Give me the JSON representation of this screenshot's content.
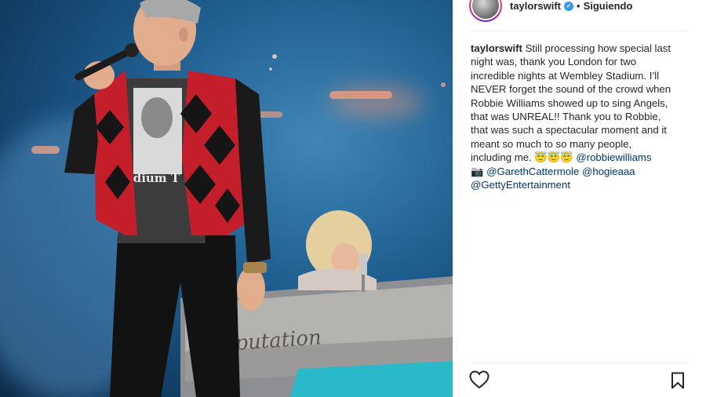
{
  "post": {
    "image_alt": "Robbie Williams singing on stage while Taylor Swift plays piano at Wembley Stadium",
    "piano_text": "putation",
    "shirt_text": "adium T"
  },
  "header": {
    "username": "taylorswift",
    "verified_icon": "verified-badge-icon",
    "separator": "•",
    "follow_status": "Siguiendo"
  },
  "caption": {
    "username": "taylorswift",
    "lines": [
      "Still processing how special last",
      "night was, thank you London for two",
      "incredible nights at Wembley Stadium. I’ll",
      "NEVER forget the sound of the crowd when",
      "Robbie Williams showed up to sing Angels,",
      "that was UNREAL!! Thank you to Robbie,",
      "that was such a spectacular moment and it",
      "meant so much to so many people,",
      "including me."
    ],
    "emojis": "😇😇😇",
    "mention_robbie": "@robbiewilliams",
    "camera_emoji": "📷",
    "mention_gareth": "@GarethCattermole",
    "mention_hogie": "@hogieaaa",
    "mention_getty": "@GettyEntertainment"
  },
  "actions": {
    "like_icon": "heart-outline-icon",
    "save_icon": "bookmark-outline-icon"
  },
  "colors": {
    "link": "#003569",
    "verified": "#3897f0",
    "text": "#262626",
    "divider": "#efefef"
  }
}
